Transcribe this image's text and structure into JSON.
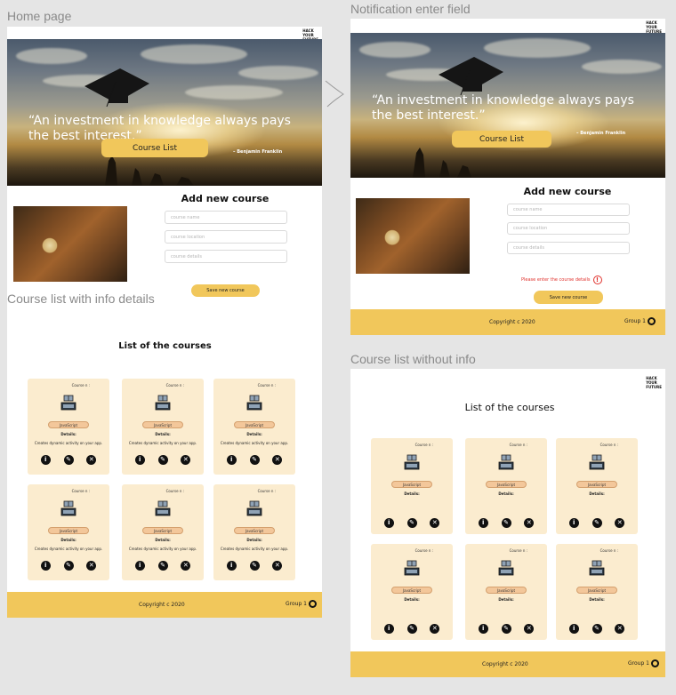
{
  "labels": {
    "home": "Home page",
    "notification": "Notification enter field",
    "with_info": "Course list with info details",
    "without_info": "Course list without info"
  },
  "logo": [
    "HACK",
    "YOUR",
    "FUTURE"
  ],
  "hero": {
    "quote": "“An investment in knowledge always pays the best interest.”",
    "author": "– Benjamin Franklin",
    "button": "Course List"
  },
  "form": {
    "title": "Add new course",
    "fields": [
      {
        "placeholder": "course name"
      },
      {
        "placeholder": "course location"
      },
      {
        "placeholder": "course details"
      }
    ],
    "save": "Save new course",
    "error": "Please enter the course details"
  },
  "list": {
    "title": "List of the courses"
  },
  "card": {
    "number": "Course n :",
    "tag": "JavaScript",
    "details": "Details:",
    "description": "Creates dynamic activity on your app."
  },
  "footer": {
    "copyright": "Copyright c 2020",
    "group": "Group 1"
  },
  "colors": {
    "accent": "#f1c75b",
    "card": "#fbeccf",
    "error": "#e0302b"
  },
  "icons": [
    "info-icon",
    "edit-icon",
    "delete-icon",
    "github-icon",
    "error-icon"
  ]
}
